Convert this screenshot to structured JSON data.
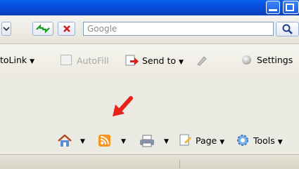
{
  "address_bar": {
    "search_placeholder": "Google"
  },
  "google_toolbar": {
    "autolink_label": "toLink",
    "autofill_label": "AutoFill",
    "send_to_label": "Send to",
    "settings_label": "Settings"
  },
  "command_bar": {
    "page_label": "Page",
    "tools_label": "Tools"
  },
  "colors": {
    "annotation_arrow": "#e8221b",
    "rss": "#f7931e",
    "titlebar": "#0b52e0"
  }
}
